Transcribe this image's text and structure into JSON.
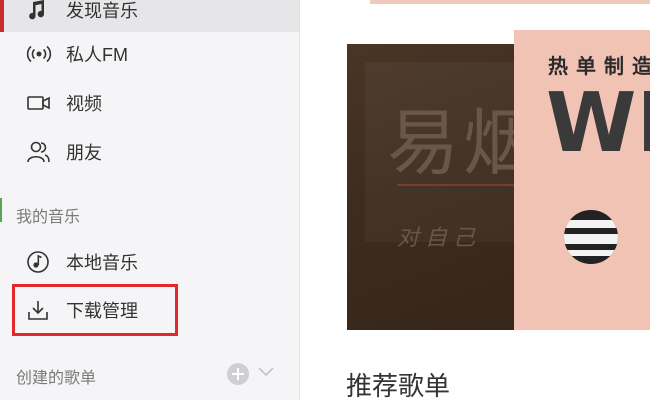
{
  "sidebar": {
    "items": [
      {
        "label": "发现音乐",
        "icon": "music-note-icon"
      },
      {
        "label": "私人FM",
        "icon": "radio-icon"
      },
      {
        "label": "视频",
        "icon": "video-icon"
      },
      {
        "label": "朋友",
        "icon": "friends-icon"
      }
    ],
    "my_music": {
      "title": "我的音乐",
      "items": [
        {
          "label": "本地音乐",
          "icon": "local-music-icon"
        },
        {
          "label": "下载管理",
          "icon": "download-icon"
        }
      ]
    },
    "created_playlists": {
      "title": "创建的歌单",
      "add_icon": "add-circle-icon",
      "toggle_icon": "chevron-down-icon"
    }
  },
  "main": {
    "banner_left": {
      "title": "易烟",
      "subtitle": "对自己"
    },
    "banner_right": {
      "label": "热单制造",
      "big_text": "WE"
    },
    "recommend_heading": "推荐歌单"
  },
  "colors": {
    "accent_red": "#c62f2f",
    "highlight_red": "#e02a2a",
    "sidebar_bg": "#f5f5f7",
    "banner_pink": "#f0c3b4"
  }
}
